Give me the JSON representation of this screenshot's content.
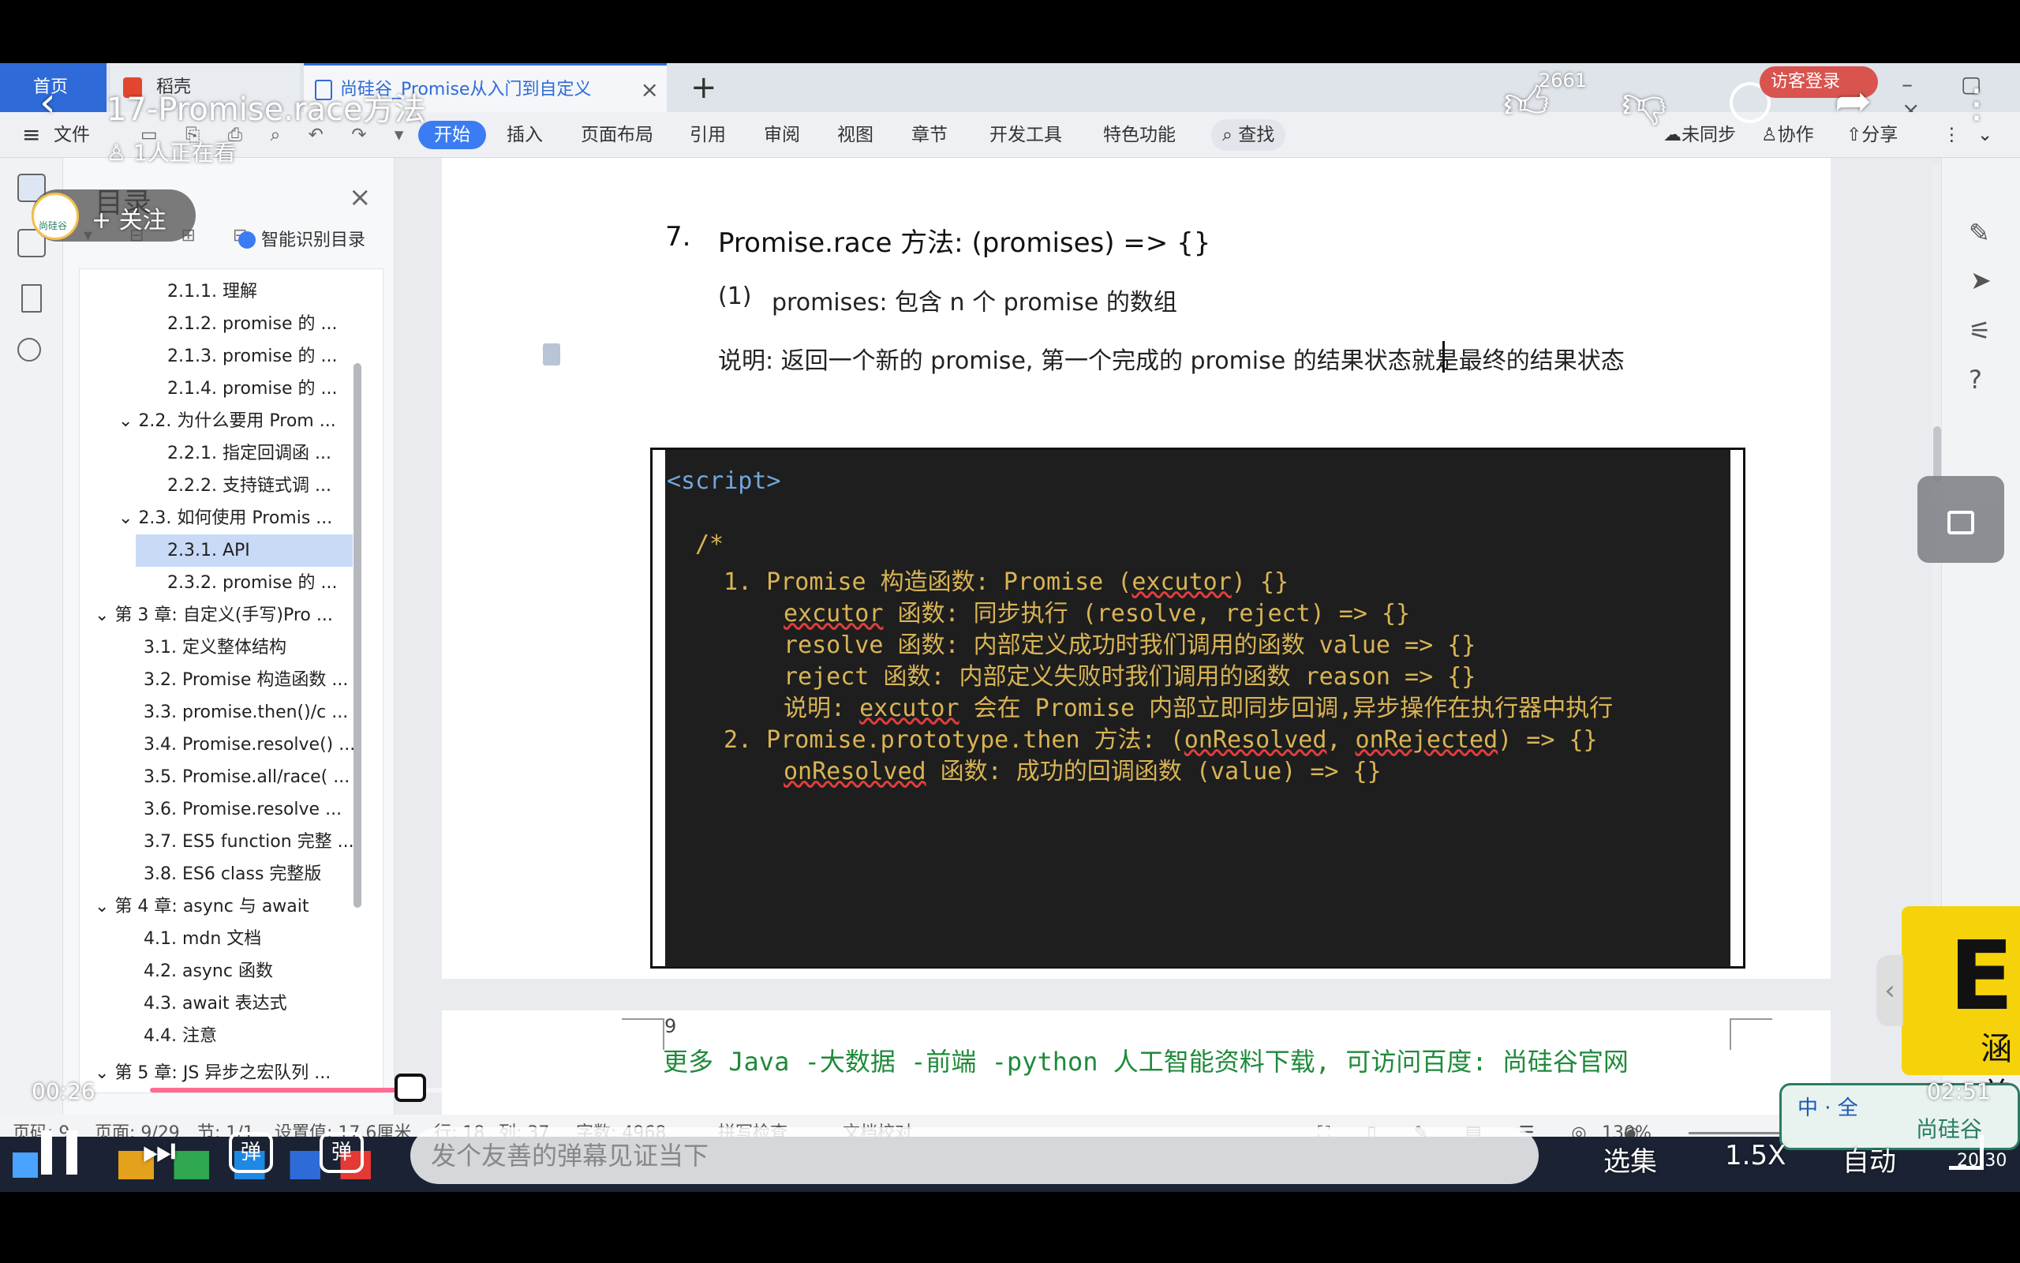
{
  "video": {
    "title": "17-Promise.race方法",
    "viewers": "1人正在看",
    "likes": "2661",
    "current_time": "00:26",
    "total_time": "02:51",
    "follow_label": "+ 关注",
    "danmu_placeholder": "发个友善的弹幕见证当下",
    "episodes_label": "选集",
    "speed_label": "1.5X",
    "quality_label": "自动",
    "danmu_toggle": "弹",
    "danmu_settings": "弹",
    "login_label": "访客登录",
    "uploader_logo": "尚硅谷"
  },
  "tabs": {
    "home": "首页",
    "wps": "稻壳",
    "doc": "尚硅谷_Promise从入门到自定义"
  },
  "ribbon": {
    "menu": "文件",
    "items": [
      "开始",
      "插入",
      "页面布局",
      "引用",
      "审阅",
      "视图",
      "章节",
      "开发工具",
      "特色功能"
    ],
    "search": "查找",
    "sync": "未同步",
    "collab": "协作",
    "share": "分享"
  },
  "toc": {
    "title": "目录",
    "smart": "智能识别目录",
    "items": [
      "2.1.1. 理解",
      "2.1.2. promise 的 ...",
      "2.1.3. promise 的 ...",
      "2.1.4. promise 的 ...",
      "2.2. 为什么要用 Prom ...",
      "2.2.1. 指定回调函 ...",
      "2.2.2. 支持链式调 ...",
      "2.3. 如何使用 Promis ...",
      "2.3.1. API",
      "2.3.2. promise 的 ...",
      "第 3 章: 自定义(手写)Pro ...",
      "3.1. 定义整体结构",
      "3.2. Promise 构造函数 ...",
      "3.3. promise.then()/c ...",
      "3.4. Promise.resolve() ...",
      "3.5. Promise.all/race( ...",
      "3.6. Promise.resolve ...",
      "3.7. ES5 function 完整 ...",
      "3.8. ES6 class 完整版",
      "第 4 章: async 与 await",
      "4.1. mdn 文档",
      "4.2. async 函数",
      "4.3. await 表达式",
      "4.4. 注意",
      "第 5 章: JS 异步之宏队列 ..."
    ]
  },
  "doc": {
    "heading_num": "7.",
    "heading": "Promise.race 方法: (promises) => {}",
    "sub_num": "(1)",
    "sub": "promises: 包含 n 个 promise 的数组",
    "note": "说明: 返回一个新的 promise, 第一个完成的 promise 的结果状态就是最终的结果状态",
    "code": {
      "l1": "<script>",
      "l2": "/*",
      "l3a": "1. Promise 构造函数: Promise (",
      "l3b": "excutor",
      "l3c": ") {}",
      "l4a": "excutor",
      "l4b": " 函数: 同步执行  (resolve, reject) => {}",
      "l5": "resolve 函数: 内部定义成功时我们调用的函数 value => {}",
      "l6": "reject 函数: 内部定义失败时我们调用的函数 reason => {}",
      "l7a": "说明: ",
      "l7b": "excutor",
      "l7c": " 会在 Promise 内部立即同步回调,异步操作在执行器中执行",
      "l8a": "2. Promise.prototype.then 方法: (",
      "l8b": "onResolved",
      "l8c": ", ",
      "l8d": "onRejected",
      "l8e": ") => {}",
      "l9a": "onResolved",
      "l9b": " 函数: 成功的回调函数  (value) => {}"
    },
    "page_number": "9",
    "footer": "更多 Java -大数据 -前端 -python 人工智能资料下载, 可访问百度: 尚硅谷官网"
  },
  "status": {
    "page": "页码: 9",
    "pages": "页面: 9/29",
    "section": "节: 1/1",
    "setting": "设置值: 17.6厘米",
    "row": "行: 18",
    "col": "列: 37",
    "words": "字数: 4968",
    "spell": "拼写检查",
    "proof": "文档校对",
    "zoom": "130%"
  },
  "taskbar": {
    "time": "20:30"
  },
  "ad": {
    "text": "ES",
    "sub": "涵盖",
    "badge_top": "中 · 全",
    "badge_brand": "尚硅谷"
  },
  "colors": {
    "accent": "#3b7cf2",
    "progress": "#ff6b93",
    "code_bg": "#1e1e1e",
    "code_text": "#d9b455",
    "footer_green": "#1f8a3b"
  }
}
